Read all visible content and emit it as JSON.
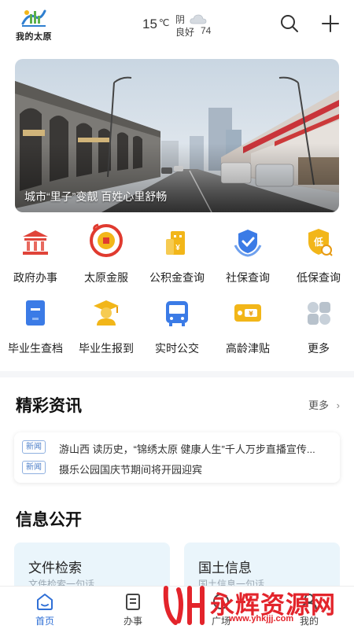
{
  "header": {
    "logo_text": "我的太原",
    "temperature": "15",
    "temp_unit": "℃",
    "condition": "阴",
    "air_quality": "良好",
    "aqi": "74",
    "icons": [
      "search-icon",
      "plus-icon"
    ]
  },
  "banner": {
    "caption": "城市“里子”变靓 百姓心里舒畅"
  },
  "services": [
    {
      "label": "政府办事",
      "icon": "government-building-icon"
    },
    {
      "label": "太原金服",
      "icon": "dragon-coin-icon"
    },
    {
      "label": "公积金查询",
      "icon": "housing-fund-icon"
    },
    {
      "label": "社保查询",
      "icon": "social-security-shield-icon"
    },
    {
      "label": "低保查询",
      "icon": "subsistence-allowance-icon"
    },
    {
      "label": "毕业生查档",
      "icon": "archive-file-icon"
    },
    {
      "label": "毕业生报到",
      "icon": "graduate-icon"
    },
    {
      "label": "实时公交",
      "icon": "bus-icon"
    },
    {
      "label": "高龄津贴",
      "icon": "elderly-allowance-card-icon"
    },
    {
      "label": "更多",
      "icon": "more-grid-icon"
    }
  ],
  "news": {
    "title": "精彩资讯",
    "more": "更多",
    "items": [
      {
        "tag": "新闻",
        "text": "游山西 读历史，“锦绣太原 健康人生”千人万步直播宣传..."
      },
      {
        "tag": "新闻",
        "text": "摄乐公园国庆节期间将开园迎宾"
      }
    ]
  },
  "info": {
    "title": "信息公开",
    "cards": [
      {
        "title": "文件检索",
        "sub": "文件检索一句话"
      },
      {
        "title": "国土信息",
        "sub": "国土信息一句话"
      }
    ]
  },
  "tabbar": {
    "tabs": [
      {
        "label": "首页",
        "active": true
      },
      {
        "label": "办事",
        "active": false
      },
      {
        "label": "广场",
        "active": false
      },
      {
        "label": "我的",
        "active": false
      }
    ]
  },
  "watermark": {
    "text": "永辉资源网",
    "url": "www.yhkjjj.com"
  },
  "colors": {
    "accent": "#2f6fd6",
    "gov_red": "#e0443a",
    "gold": "#f2b619",
    "blue": "#3b7be6",
    "watermark_red": "#e3242b"
  }
}
